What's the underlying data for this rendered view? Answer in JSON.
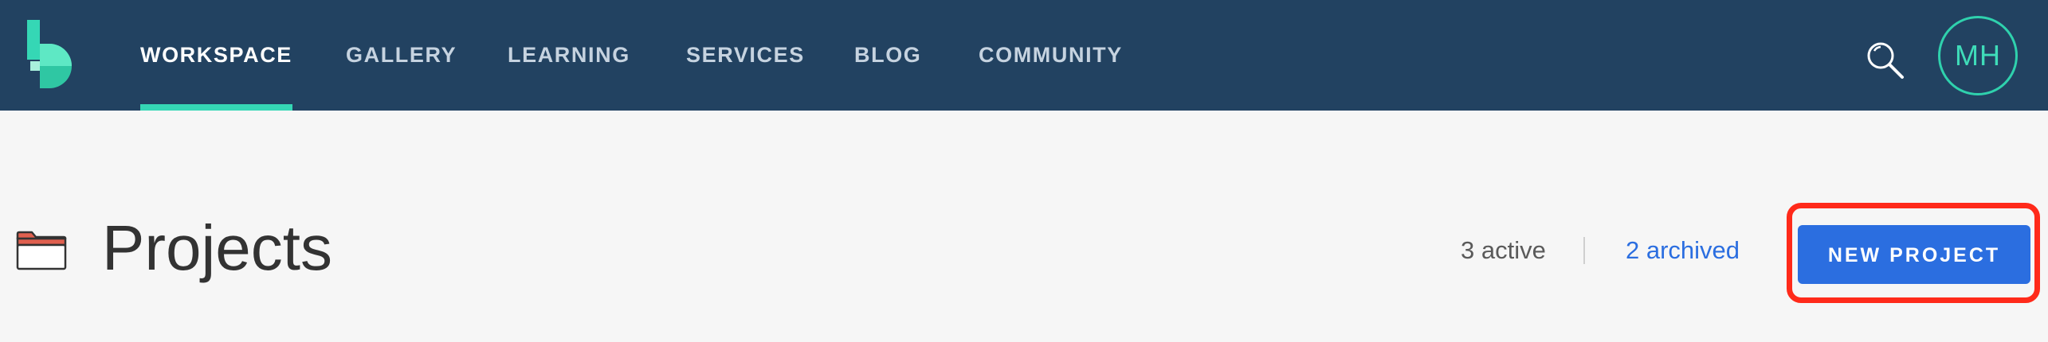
{
  "nav": {
    "items": [
      {
        "label": "WORKSPACE",
        "active": true
      },
      {
        "label": "GALLERY",
        "active": false
      },
      {
        "label": "LEARNING",
        "active": false
      },
      {
        "label": "SERVICES",
        "active": false
      },
      {
        "label": "BLOG",
        "active": false
      },
      {
        "label": "COMMUNITY",
        "active": false
      }
    ],
    "search_icon": "search-icon",
    "avatar_initials": "MH"
  },
  "header": {
    "icon": "folder-icon",
    "title": "Projects",
    "active_count": "3 active",
    "archived_count": "2 archived",
    "new_project_label": "NEW PROJECT"
  },
  "colors": {
    "navbar": "#224261",
    "accent_teal": "#35d7b5",
    "primary_blue": "#2b6ee0",
    "highlight_red": "#ff2a1a",
    "background": "#f6f6f6"
  }
}
